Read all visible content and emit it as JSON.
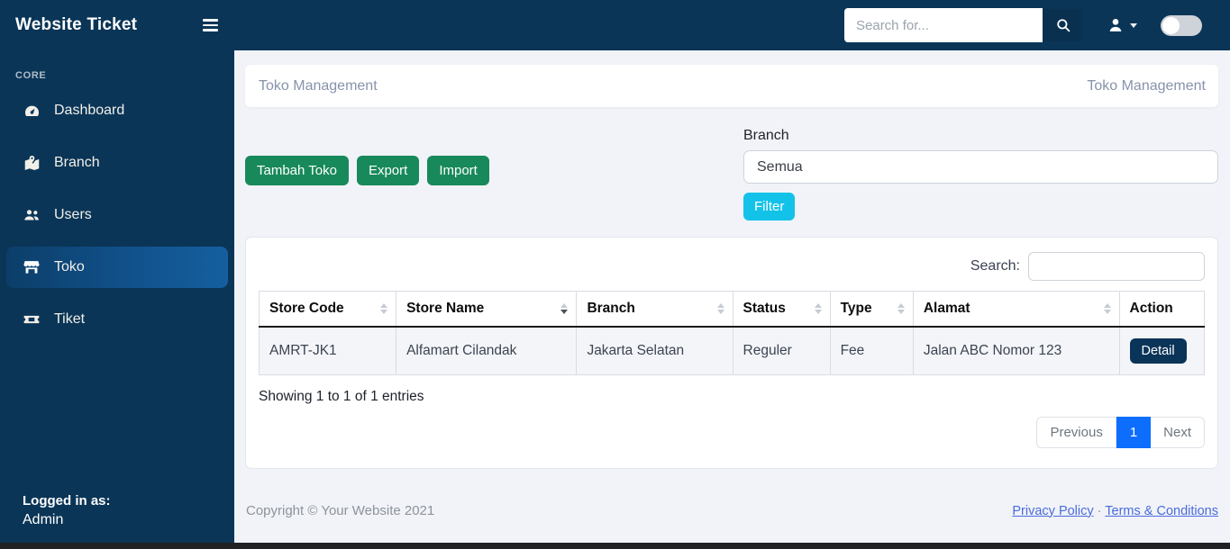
{
  "navbar": {
    "brand": "Website Ticket",
    "search_placeholder": "Search for..."
  },
  "sidebar": {
    "section_label": "CORE",
    "items": [
      {
        "label": "Dashboard",
        "icon": "tachometer-icon",
        "active": false
      },
      {
        "label": "Branch",
        "icon": "map-marked-icon",
        "active": false
      },
      {
        "label": "Users",
        "icon": "users-icon",
        "active": false
      },
      {
        "label": "Toko",
        "icon": "store-icon",
        "active": true
      },
      {
        "label": "Tiket",
        "icon": "ticket-icon",
        "active": false
      }
    ],
    "logged_in_label": "Logged in as:",
    "logged_in_user": "Admin"
  },
  "breadcrumb": {
    "left": "Toko Management",
    "right": "Toko Management"
  },
  "toolbar": {
    "add_label": "Tambah Toko",
    "export_label": "Export",
    "import_label": "Import"
  },
  "filter": {
    "label": "Branch",
    "selected_option": "Semua",
    "button_label": "Filter"
  },
  "table": {
    "search_label": "Search:",
    "search_value": "",
    "columns": [
      "Store Code",
      "Store Name",
      "Branch",
      "Status",
      "Type",
      "Alamat",
      "Action"
    ],
    "sorted_column": "Store Name",
    "rows": [
      {
        "store_code": "AMRT-JK1",
        "store_name": "Alfamart Cilandak",
        "branch": "Jakarta Selatan",
        "status": "Reguler",
        "type": "Fee",
        "alamat": "Jalan ABC Nomor 123",
        "action_label": "Detail"
      }
    ],
    "info": "Showing 1 to 1 of 1 entries",
    "pagination": {
      "previous": "Previous",
      "page": "1",
      "next": "Next"
    }
  },
  "footer": {
    "copyright": "Copyright © Your Website 2021",
    "link_privacy": "Privacy Policy",
    "separator": "·",
    "link_terms": "Terms & Conditions"
  },
  "colors": {
    "navy": "#0a3557",
    "active_gradient_start": "#0c3e69",
    "active_gradient_end": "#155f9f",
    "green": "#18895a",
    "cyan": "#13c2e9",
    "pagination_blue": "#0d6efd",
    "link_blue": "#4a6bdd",
    "content_bg": "#f1f3f8"
  }
}
